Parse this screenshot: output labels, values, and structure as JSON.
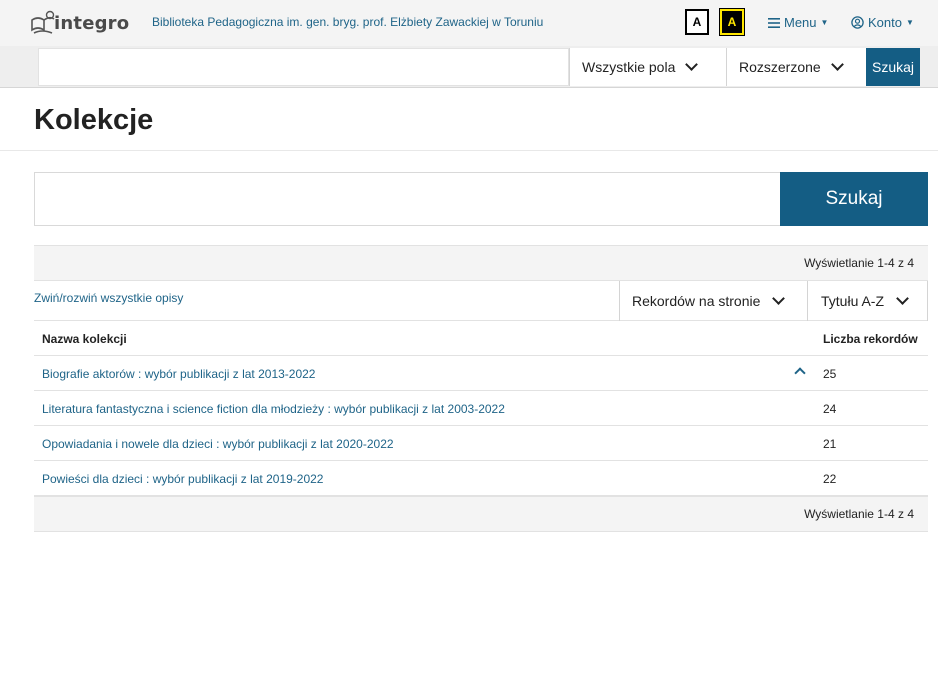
{
  "header": {
    "logo_text": "integro",
    "library_name": "Biblioteka Pedagogiczna im. gen. bryg. prof. Elżbiety Zawackiej w Toruniu",
    "contrast_normal_label": "A",
    "contrast_high_label": "A",
    "menu_label": "Menu",
    "account_label": "Konto"
  },
  "top_search": {
    "input_value": "",
    "field_select_value": "Wszystkie pola",
    "mode_select_value": "Rozszerzone",
    "button_label": "Szukaj"
  },
  "page": {
    "title": "Kolekcje"
  },
  "main_search": {
    "input_value": "",
    "button_label": "Szukaj"
  },
  "results": {
    "summary_top": "Wyświetlanie 1-4 z 4",
    "summary_bottom": "Wyświetlanie 1-4 z 4",
    "toggle_all_label": "Zwiń/rozwiń wszystkie opisy",
    "per_page_label": "Rekordów na stronie",
    "sort_label": "Tytułu A-Z",
    "columns": {
      "name": "Nazwa kolekcji",
      "count": "Liczba rekordów"
    },
    "rows": [
      {
        "name": "Biografie aktorów : wybór publikacji z lat 2013-2022",
        "count": "25",
        "expanded": true
      },
      {
        "name": "Literatura fantastyczna i science fiction dla młodzieży : wybór publikacji z lat 2003-2022",
        "count": "24"
      },
      {
        "name": "Opowiadania i nowele dla dzieci : wybór publikacji z lat 2020-2022",
        "count": "21"
      },
      {
        "name": "Powieści dla dzieci : wybór publikacji z lat 2019-2022",
        "count": "22"
      }
    ]
  },
  "icons": {
    "menu": "hamburger-icon",
    "account": "user-circle-icon",
    "dropdown": "chevron-down-icon",
    "expand": "chevron-up-icon"
  },
  "colors": {
    "accent": "#145d84",
    "link": "#1f6488",
    "high_contrast_text": "#ffe600"
  }
}
